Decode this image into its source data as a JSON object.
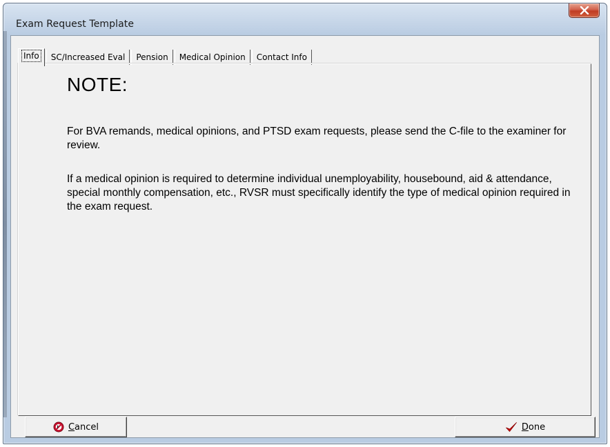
{
  "window": {
    "title": "Exam Request Template"
  },
  "tabs": [
    {
      "label": "Info",
      "active": true
    },
    {
      "label": "SC/Increased Eval",
      "active": false
    },
    {
      "label": "Pension",
      "active": false
    },
    {
      "label": "Medical Opinion",
      "active": false
    },
    {
      "label": "Contact Info",
      "active": false
    }
  ],
  "info_panel": {
    "heading": "NOTE:",
    "paragraph1": "For BVA remands, medical opinions,  and PTSD exam requests, please send the C-file to the examiner for review.",
    "paragraph2": "If a medical opinion is required to determine individual unemployability, housebound, aid & attendance, special monthly compensation, etc., RVSR must specifically identify the type of medical opinion required in the exam request."
  },
  "buttons": {
    "cancel": {
      "mnemonic": "C",
      "rest": "ancel",
      "icon": "cancel-icon"
    },
    "done": {
      "mnemonic": "D",
      "rest": "one",
      "icon": "checkmark-icon"
    }
  },
  "colors": {
    "cancel_icon": "#c8102e",
    "done_icon": "#cc0000",
    "close_button": "#c7442b"
  }
}
